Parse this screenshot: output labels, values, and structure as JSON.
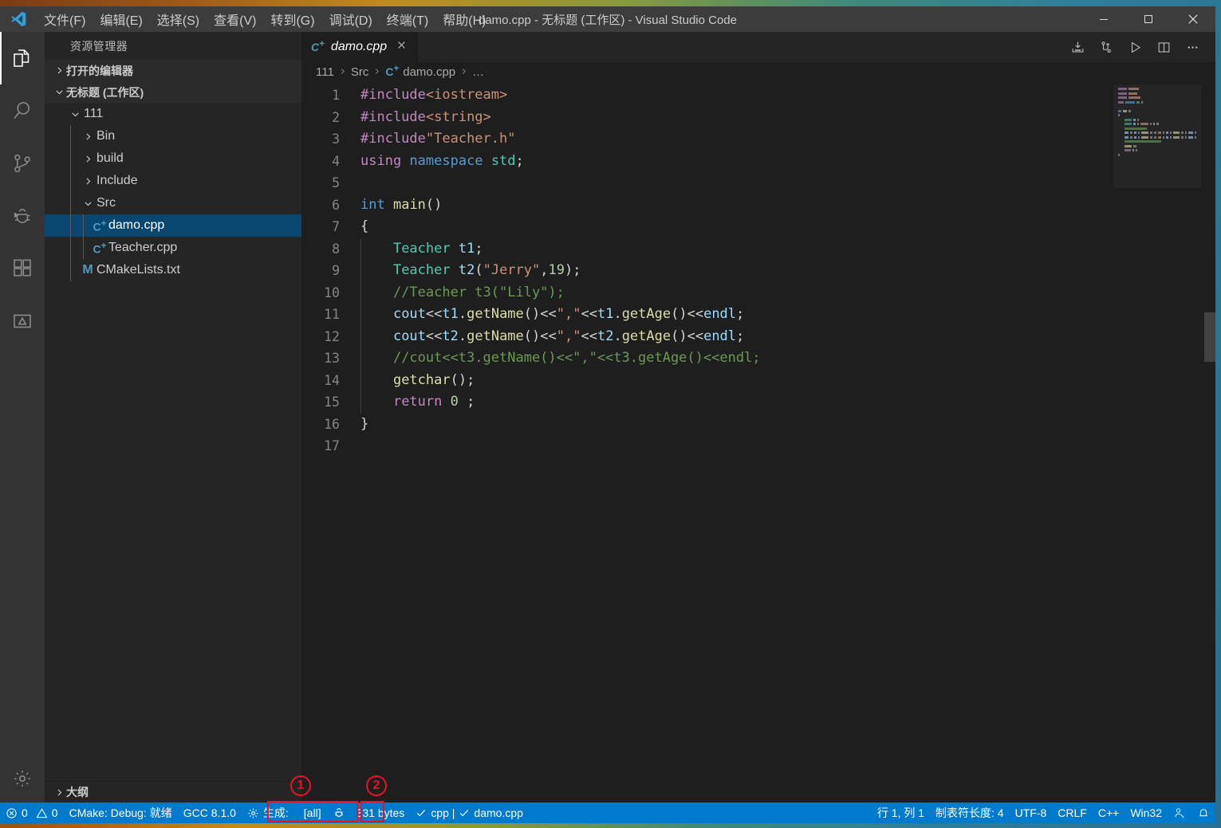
{
  "window": {
    "title": "damo.cpp - 无标题 (工作区) - Visual Studio Code",
    "logo_icon": "vscode-logo-icon",
    "minimize_label": "最小化",
    "maximize_label": "最大化",
    "close_label": "关闭",
    "accent_color": "#007acc",
    "titlebar_color": "#3c3c3c",
    "editor_bg": "#1e1e1e",
    "sidebar_bg": "#252526"
  },
  "menu": [
    {
      "label": "文件(F)",
      "name": "menu-file"
    },
    {
      "label": "编辑(E)",
      "name": "menu-edit"
    },
    {
      "label": "选择(S)",
      "name": "menu-selection"
    },
    {
      "label": "查看(V)",
      "name": "menu-view"
    },
    {
      "label": "转到(G)",
      "name": "menu-goto"
    },
    {
      "label": "调试(D)",
      "name": "menu-debug"
    },
    {
      "label": "终端(T)",
      "name": "menu-terminal"
    },
    {
      "label": "帮助(H)",
      "name": "menu-help"
    }
  ],
  "activitybar": [
    {
      "icon": "files-explorer-icon",
      "label": "资源管理器",
      "active": true
    },
    {
      "icon": "search-icon",
      "label": "搜索",
      "active": false
    },
    {
      "icon": "source-control-icon",
      "label": "源代码管理",
      "active": false
    },
    {
      "icon": "debug-icon",
      "label": "调试",
      "active": false
    },
    {
      "icon": "extensions-icon",
      "label": "扩展",
      "active": false
    },
    {
      "icon": "cmake-icon",
      "label": "CMake",
      "active": false
    }
  ],
  "activitybar_bottom": [
    {
      "icon": "gear-icon",
      "label": "管理"
    }
  ],
  "sidebar": {
    "title": "资源管理器",
    "sections": [
      {
        "label": "打开的编辑器",
        "expanded": false,
        "name": "section-open-editors"
      },
      {
        "label": "无标题 (工作区)",
        "expanded": true,
        "name": "section-workspace"
      }
    ],
    "tree": [
      {
        "label": "111",
        "type": "folder",
        "expanded": true,
        "depth": 1,
        "selected": false
      },
      {
        "label": "Bin",
        "type": "folder",
        "expanded": false,
        "depth": 2,
        "selected": false
      },
      {
        "label": "build",
        "type": "folder",
        "expanded": false,
        "depth": 2,
        "selected": false
      },
      {
        "label": "Include",
        "type": "folder",
        "expanded": false,
        "depth": 2,
        "selected": false
      },
      {
        "label": "Src",
        "type": "folder",
        "expanded": true,
        "depth": 2,
        "selected": false
      },
      {
        "label": "damo.cpp",
        "type": "cpp",
        "depth": 3,
        "selected": true
      },
      {
        "label": "Teacher.cpp",
        "type": "cpp",
        "depth": 3,
        "selected": false
      },
      {
        "label": "CMakeLists.txt",
        "type": "cmake",
        "depth": 2,
        "selected": false
      }
    ],
    "outline": {
      "label": "大纲",
      "expanded": false
    }
  },
  "editor": {
    "tabs": [
      {
        "label": "damo.cpp",
        "icon": "cpp-file-icon",
        "active": true,
        "close_icon": "close-icon",
        "italic": true
      }
    ],
    "actions": [
      {
        "icon": "save-all-icon",
        "name": "action-run-cmake-build"
      },
      {
        "icon": "compare-changes-icon",
        "name": "action-compare"
      },
      {
        "icon": "run-icon",
        "name": "action-run"
      },
      {
        "icon": "split-editor-icon",
        "name": "action-split-editor"
      },
      {
        "icon": "more-actions-icon",
        "name": "action-more"
      }
    ],
    "breadcrumbs": [
      "111",
      "Src",
      "damo.cpp",
      "…"
    ],
    "breadcrumb_file_icon": "cpp-file-icon",
    "lines": [
      {
        "n": 1,
        "indent": 0,
        "tokens": [
          {
            "t": "#include",
            "c": "t-pre"
          },
          {
            "t": "<iostream>",
            "c": "t-str"
          }
        ]
      },
      {
        "n": 2,
        "indent": 0,
        "tokens": [
          {
            "t": "#include",
            "c": "t-pre"
          },
          {
            "t": "<string>",
            "c": "t-str"
          }
        ]
      },
      {
        "n": 3,
        "indent": 0,
        "tokens": [
          {
            "t": "#include",
            "c": "t-pre"
          },
          {
            "t": "\"Teacher.h\"",
            "c": "t-str"
          }
        ]
      },
      {
        "n": 4,
        "indent": 0,
        "tokens": [
          {
            "t": "using",
            "c": "t-ctl"
          },
          {
            "t": " ",
            "c": "t-pln"
          },
          {
            "t": "namespace",
            "c": "t-kw"
          },
          {
            "t": " ",
            "c": "t-pln"
          },
          {
            "t": "std",
            "c": "t-ns"
          },
          {
            "t": ";",
            "c": "t-pln"
          }
        ]
      },
      {
        "n": 5,
        "indent": 0,
        "tokens": []
      },
      {
        "n": 6,
        "indent": 0,
        "tokens": [
          {
            "t": "int",
            "c": "t-kw"
          },
          {
            "t": " ",
            "c": "t-pln"
          },
          {
            "t": "main",
            "c": "t-fn"
          },
          {
            "t": "()",
            "c": "t-pln"
          }
        ]
      },
      {
        "n": 7,
        "indent": 0,
        "tokens": [
          {
            "t": "{",
            "c": "t-pln"
          }
        ]
      },
      {
        "n": 8,
        "indent": 1,
        "tokens": [
          {
            "t": "    ",
            "c": "t-pln"
          },
          {
            "t": "Teacher",
            "c": "t-type"
          },
          {
            "t": " ",
            "c": "t-pln"
          },
          {
            "t": "t1",
            "c": "t-var"
          },
          {
            "t": ";",
            "c": "t-pln"
          }
        ]
      },
      {
        "n": 9,
        "indent": 1,
        "tokens": [
          {
            "t": "    ",
            "c": "t-pln"
          },
          {
            "t": "Teacher",
            "c": "t-type"
          },
          {
            "t": " ",
            "c": "t-pln"
          },
          {
            "t": "t2",
            "c": "t-var"
          },
          {
            "t": "(",
            "c": "t-pln"
          },
          {
            "t": "\"Jerry\"",
            "c": "t-str"
          },
          {
            "t": ",",
            "c": "t-pln"
          },
          {
            "t": "19",
            "c": "t-num"
          },
          {
            "t": ");",
            "c": "t-pln"
          }
        ]
      },
      {
        "n": 10,
        "indent": 1,
        "tokens": [
          {
            "t": "    ",
            "c": "t-pln"
          },
          {
            "t": "//Teacher t3(\"Lily\");",
            "c": "t-cmt"
          }
        ]
      },
      {
        "n": 11,
        "indent": 1,
        "tokens": [
          {
            "t": "    ",
            "c": "t-pln"
          },
          {
            "t": "cout",
            "c": "t-var"
          },
          {
            "t": "<<",
            "c": "t-pln"
          },
          {
            "t": "t1",
            "c": "t-var"
          },
          {
            "t": ".",
            "c": "t-pln"
          },
          {
            "t": "getName",
            "c": "t-fn"
          },
          {
            "t": "()",
            "c": "t-pln"
          },
          {
            "t": "<<",
            "c": "t-pln"
          },
          {
            "t": "\",\"",
            "c": "t-str"
          },
          {
            "t": "<<",
            "c": "t-pln"
          },
          {
            "t": "t1",
            "c": "t-var"
          },
          {
            "t": ".",
            "c": "t-pln"
          },
          {
            "t": "getAge",
            "c": "t-fn"
          },
          {
            "t": "()",
            "c": "t-pln"
          },
          {
            "t": "<<",
            "c": "t-pln"
          },
          {
            "t": "endl",
            "c": "t-var"
          },
          {
            "t": ";",
            "c": "t-pln"
          }
        ]
      },
      {
        "n": 12,
        "indent": 1,
        "tokens": [
          {
            "t": "    ",
            "c": "t-pln"
          },
          {
            "t": "cout",
            "c": "t-var"
          },
          {
            "t": "<<",
            "c": "t-pln"
          },
          {
            "t": "t2",
            "c": "t-var"
          },
          {
            "t": ".",
            "c": "t-pln"
          },
          {
            "t": "getName",
            "c": "t-fn"
          },
          {
            "t": "()",
            "c": "t-pln"
          },
          {
            "t": "<<",
            "c": "t-pln"
          },
          {
            "t": "\",\"",
            "c": "t-str"
          },
          {
            "t": "<<",
            "c": "t-pln"
          },
          {
            "t": "t2",
            "c": "t-var"
          },
          {
            "t": ".",
            "c": "t-pln"
          },
          {
            "t": "getAge",
            "c": "t-fn"
          },
          {
            "t": "()",
            "c": "t-pln"
          },
          {
            "t": "<<",
            "c": "t-pln"
          },
          {
            "t": "endl",
            "c": "t-var"
          },
          {
            "t": ";",
            "c": "t-pln"
          }
        ]
      },
      {
        "n": 13,
        "indent": 1,
        "tokens": [
          {
            "t": "    ",
            "c": "t-pln"
          },
          {
            "t": "//cout<<t3.getName()<<\",\"<<t3.getAge()<<endl;",
            "c": "t-cmt"
          }
        ]
      },
      {
        "n": 14,
        "indent": 1,
        "tokens": [
          {
            "t": "    ",
            "c": "t-pln"
          },
          {
            "t": "getchar",
            "c": "t-fn"
          },
          {
            "t": "();",
            "c": "t-pln"
          }
        ]
      },
      {
        "n": 15,
        "indent": 1,
        "tokens": [
          {
            "t": "    ",
            "c": "t-pln"
          },
          {
            "t": "return",
            "c": "t-ctl"
          },
          {
            "t": " ",
            "c": "t-pln"
          },
          {
            "t": "0",
            "c": "t-num"
          },
          {
            "t": " ;",
            "c": "t-pln"
          }
        ]
      },
      {
        "n": 16,
        "indent": 0,
        "tokens": [
          {
            "t": "}",
            "c": "t-pln"
          }
        ]
      },
      {
        "n": 17,
        "indent": 0,
        "tokens": []
      }
    ]
  },
  "statusbar": {
    "left": [
      {
        "name": "problems",
        "icon": "error-icon",
        "text": "0",
        "icon2": "warning-icon",
        "text2": "0"
      },
      {
        "name": "cmake-status",
        "text": "CMake: Debug: 就绪"
      },
      {
        "name": "compiler-kit",
        "text": "GCC 8.1.0"
      },
      {
        "name": "build-target",
        "icon": "gear-icon",
        "text": "生成:",
        "text2": "[all]"
      },
      {
        "name": "debug-target",
        "icon": "bug-icon",
        "text": ""
      },
      {
        "name": "file-size",
        "text": "331 bytes"
      },
      {
        "name": "cpp-check",
        "icon": "check-icon",
        "text": "cpp | ",
        "icon2": "check-icon",
        "text2": "damo.cpp"
      }
    ],
    "right": [
      {
        "name": "cursor-position",
        "text": "行 1, 列 1"
      },
      {
        "name": "tab-size",
        "text": "制表符长度: 4"
      },
      {
        "name": "encoding",
        "text": "UTF-8"
      },
      {
        "name": "eol",
        "text": "CRLF"
      },
      {
        "name": "language-mode",
        "text": "C++"
      },
      {
        "name": "platform",
        "text": "Win32"
      },
      {
        "name": "live-share",
        "icon": "live-share-icon",
        "text": ""
      },
      {
        "name": "notifications",
        "icon": "bell-icon",
        "text": ""
      }
    ]
  },
  "annotations": [
    {
      "label": "1",
      "target": "build-target-status-item"
    },
    {
      "label": "2",
      "target": "debug-target-status-item"
    }
  ]
}
